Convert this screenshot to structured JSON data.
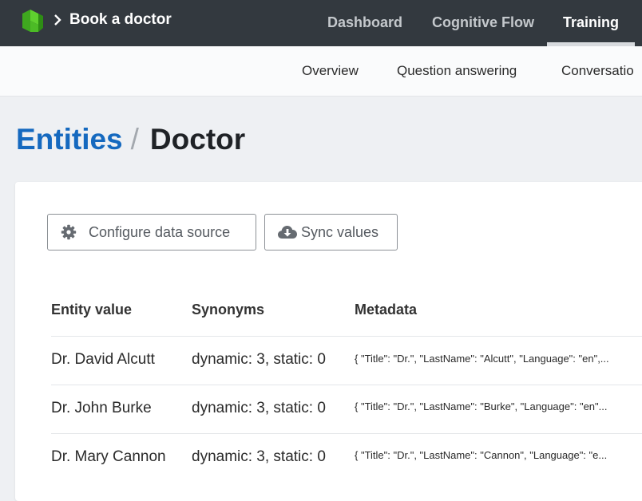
{
  "header": {
    "app_title": "Book a doctor",
    "tabs": [
      {
        "label": "Dashboard"
      },
      {
        "label": "Cognitive Flow"
      },
      {
        "label": "Training",
        "active": true
      }
    ]
  },
  "subnav": {
    "tabs": [
      {
        "label": "Overview"
      },
      {
        "label": "Question answering"
      },
      {
        "label": "Conversatio"
      }
    ]
  },
  "breadcrumb": {
    "parent": "Entities",
    "separator": "/",
    "current": "Doctor"
  },
  "toolbar": {
    "configure_label": "Configure data source",
    "sync_label": "Sync values"
  },
  "table": {
    "columns": [
      "Entity value",
      "Synonyms",
      "Metadata"
    ],
    "rows": [
      {
        "value": "Dr. David Alcutt",
        "synonyms": "dynamic: 3, static: 0",
        "metadata": "{ \"Title\": \"Dr.\", \"LastName\": \"Alcutt\", \"Language\": \"en\",..."
      },
      {
        "value": "Dr. John Burke",
        "synonyms": "dynamic: 3, static: 0",
        "metadata": "{ \"Title\": \"Dr.\", \"LastName\": \"Burke\", \"Language\": \"en\"..."
      },
      {
        "value": "Dr. Mary Cannon",
        "synonyms": "dynamic: 3, static: 0",
        "metadata": "{ \"Title\": \"Dr.\", \"LastName\": \"Cannon\", \"Language\": \"e..."
      }
    ]
  },
  "icons": {
    "logo": "brand-logo-icon",
    "chevron": "chevron-right-icon",
    "gear": "gear-icon",
    "cloud": "cloud-download-icon"
  },
  "colors": {
    "topbar": "#33393f",
    "logo_green": "#5fd02f",
    "link_blue": "#1569bf"
  }
}
